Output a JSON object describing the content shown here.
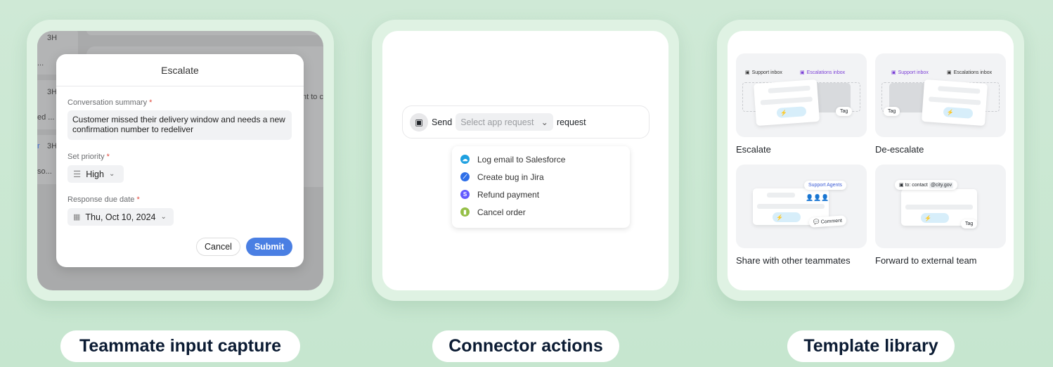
{
  "panels": [
    {
      "label": "Teammate input capture"
    },
    {
      "label": "Connector actions"
    },
    {
      "label": "Template library"
    }
  ],
  "background_fragments": {
    "time": "3H",
    "f1": "...",
    "f2": "ed ...",
    "f3": "r",
    "f4": "so...",
    "f5": "nt to c"
  },
  "modal": {
    "title": "Escalate",
    "summary_label": "Conversation summary",
    "required": "*",
    "summary_value": "Customer missed their delivery window and needs a new confirmation number to redeliver",
    "priority_label": "Set priority",
    "priority_value": "High",
    "due_label": "Response due date",
    "due_value": "Thu, Oct 10, 2024",
    "cancel": "Cancel",
    "submit": "Submit",
    "accent": "#4a7fe3"
  },
  "connector": {
    "send": "Send",
    "placeholder": "Select app request",
    "suffix": "request",
    "items": [
      {
        "label": "Log email to Salesforce",
        "icon": "salesforce-icon",
        "color": "#1ea0e0"
      },
      {
        "label": "Create bug in Jira",
        "icon": "jira-icon",
        "color": "#2e6fe8"
      },
      {
        "label": "Refund payment",
        "icon": "stripe-icon",
        "color": "#635bff"
      },
      {
        "label": "Cancel order",
        "icon": "shopify-icon",
        "color": "#95bf47"
      }
    ]
  },
  "templates": {
    "items": [
      {
        "title": "Escalate",
        "from": "Support inbox",
        "to": "Escalations inbox",
        "tag": "Tag"
      },
      {
        "title": "De-escalate",
        "from": "Support inbox",
        "to": "Escalations inbox",
        "tag": "Tag"
      },
      {
        "title": "Share with other teammates",
        "group": "Support Agents",
        "comment": "Comment"
      },
      {
        "title": "Forward to external team",
        "to": "to: contact",
        "domain": "@city.gov",
        "tag": "Tag"
      }
    ],
    "accent": "#7b3fd6"
  }
}
